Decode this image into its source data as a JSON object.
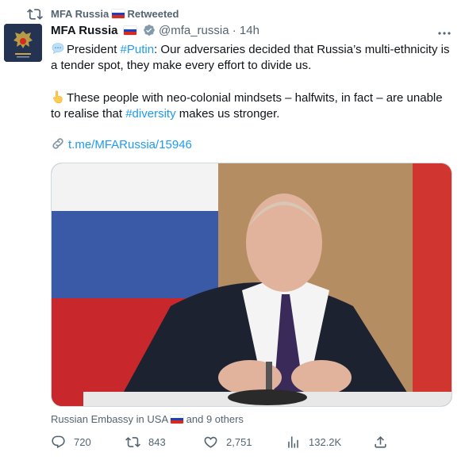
{
  "retweet": {
    "label": "MFA Russia",
    "suffix": "Retweeted"
  },
  "author": {
    "name": "MFA Russia",
    "handle": "@mfa_russia",
    "separator": "·",
    "time": "14h"
  },
  "tweet": {
    "line1_prefix": "President ",
    "line1_hashtag": "#Putin",
    "line1_rest": ": Our adversaries decided that Russia’s multi-ethnicity is a tender spot, they make every effort to divide us.",
    "line2_prefix": "These people with neo-colonial mindsets – halfwits, in fact – are unable to realise that ",
    "line2_hashtag": "#diversity",
    "line2_rest": " makes us stronger.",
    "link": "t.me/MFARussia/15946"
  },
  "tagged": {
    "prefix": "Russian Embassy in USA",
    "suffix": "and 9 others"
  },
  "metrics": {
    "replies": "720",
    "retweets": "843",
    "likes": "2,751",
    "views": "132.2K"
  },
  "icons": [
    "retweet-icon",
    "flag-russia-icon",
    "verified-badge-icon",
    "more-icon",
    "speech-bubble-icon",
    "pointing-hand-icon",
    "link-icon",
    "reply-icon",
    "like-icon",
    "views-icon",
    "share-icon"
  ],
  "colors": {
    "accent": "#1d9bf0",
    "muted": "#536471",
    "text": "#0f1419"
  }
}
